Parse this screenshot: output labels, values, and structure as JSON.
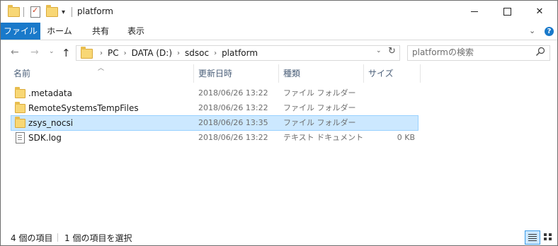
{
  "window": {
    "title": "platform"
  },
  "ribbon": {
    "tabs": [
      "ファイル",
      "ホーム",
      "共有",
      "表示"
    ],
    "accent": "#1979ca"
  },
  "address": {
    "crumbs": [
      "PC",
      "DATA (D:)",
      "sdsoc",
      "platform"
    ]
  },
  "search": {
    "placeholder": "platformの検索"
  },
  "columns": {
    "name": "名前",
    "date": "更新日時",
    "type": "種類",
    "size": "サイズ"
  },
  "files": [
    {
      "name": ".metadata",
      "date": "2018/06/26 13:22",
      "type": "ファイル フォルダー",
      "size": "",
      "icon": "folder-icon",
      "selected": false
    },
    {
      "name": "RemoteSystemsTempFiles",
      "date": "2018/06/26 13:22",
      "type": "ファイル フォルダー",
      "size": "",
      "icon": "folder-icon",
      "selected": false
    },
    {
      "name": "zsys_nocsi",
      "date": "2018/06/26 13:35",
      "type": "ファイル フォルダー",
      "size": "",
      "icon": "folder-icon",
      "selected": true
    },
    {
      "name": "SDK.log",
      "date": "2018/06/26 13:22",
      "type": "テキスト ドキュメント",
      "size": "0 KB",
      "icon": "text-file-icon",
      "selected": false
    }
  ],
  "status": {
    "item_count": "4 個の項目",
    "selection": "1 個の項目を選択"
  },
  "colors": {
    "selection_bg": "#cce8ff",
    "selection_border": "#99d1ff",
    "folder": "#f8d775"
  }
}
